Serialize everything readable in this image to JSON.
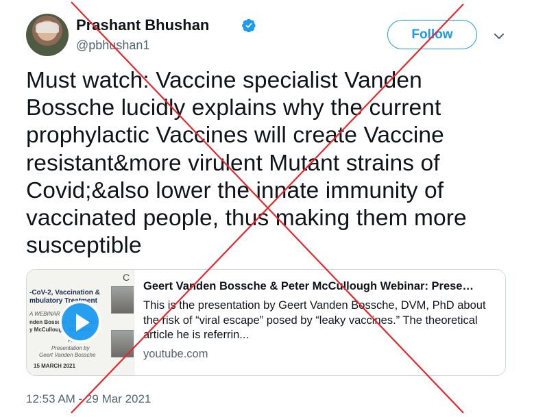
{
  "tweet": {
    "author": {
      "display_name": "Prashant Bhushan",
      "handle": "@pbhushan1",
      "verified": true
    },
    "follow_label": "Follow",
    "text": "Must watch: Vaccine specialist Vanden Bossche lucidly explains why the current prophylactic Vaccines will create Vaccine resistant&more virulent Mutant strains of Covid;&also lower the innate immunity of vaccinated people, thus making them more susceptible",
    "timestamp": "12:53 AM - 29 Mar 2021"
  },
  "link_card": {
    "title": "Geert Vanden Bossche & Peter McCullough Webinar: Prese…",
    "description": "This is the presentation by Geert Vanden Bossche, DVM, PhD about the risk of “viral escape” posed by “leaky vaccines.” The theoretical article he is referrin...",
    "domain": "youtube.com",
    "thumbnail": {
      "title_line1": "-CoV-2, Vaccination &",
      "title_line2": "mbulatory Treatment",
      "line3": "A WEBINAR",
      "line4": "nden Bossche, DVM, PhD",
      "line5": "y McCullough, MD, MPH",
      "line6": "PART II",
      "line7": "Presentation by",
      "line8": "Geert Vanden Bossche",
      "date": "15 MARCH 2021",
      "topmark": "C"
    }
  },
  "overlay": {
    "cross_color": "#e8262b"
  },
  "colors": {
    "accent": "#1d9bf0",
    "text": "#0f1419",
    "muted": "#536471",
    "border": "#cfd9de"
  }
}
